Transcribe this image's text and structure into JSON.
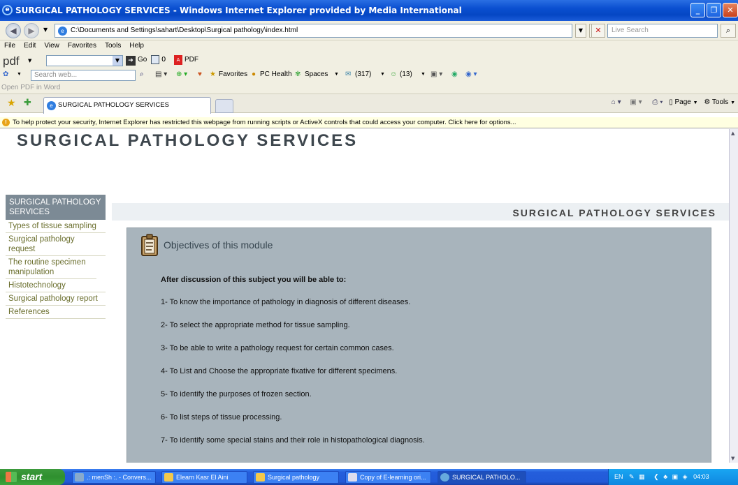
{
  "window": {
    "title": "SURGICAL PATHOLOGY SERVICES - Windows Internet Explorer provided by Media International"
  },
  "address": {
    "url": "C:\\Documents and Settings\\sahart\\Desktop\\Surgical pathology\\index.html",
    "search_placeholder": "Live Search"
  },
  "menu": {
    "items": [
      "File",
      "Edit",
      "View",
      "Favorites",
      "Tools",
      "Help"
    ]
  },
  "pdf_toolbar": {
    "logo": "pdf",
    "go_label": "Go",
    "count": "0",
    "pdf_label": "PDF"
  },
  "toolbar2": {
    "search_placeholder": "Search web...",
    "favorites": "Favorites",
    "pc_health": "PC Health",
    "spaces": "Spaces",
    "mail_count": "(317)",
    "people_count": "(13)",
    "open_pdf": "Open PDF in Word"
  },
  "tabs": {
    "active": "SURGICAL PATHOLOGY SERVICES",
    "page_menu": "Page",
    "tools_menu": "Tools"
  },
  "security_bar": {
    "text": "To help protect your security, Internet Explorer has restricted this webpage from running scripts or ActiveX controls that could access your computer. Click here for options..."
  },
  "site": {
    "title": "SURGICAL PATHOLOGY SERVICES",
    "sidebar_header": "SURGICAL PATHOLOGY SERVICES",
    "nav": [
      "Types of tissue sampling",
      "Surgical pathology request",
      "The routine specimen manipulation",
      "Histotechnology",
      "Surgical pathology report",
      "References"
    ],
    "banner": "SURGICAL PATHOLOGY SERVICES",
    "panel_title": "Objectives of this module",
    "intro": "After discussion of this subject you will be able to:",
    "objectives": [
      "1- To know the importance of pathology in diagnosis of different diseases.",
      "2- To select the appropriate method for tissue sampling.",
      "3- To be able to write a pathology request for certain common cases.",
      "4- To List and Choose the appropriate fixative for different specimens.",
      "5- To identify the purposes of frozen section.",
      "6- To list steps of tissue processing.",
      "7- To identify some special stains and their role in histopathological diagnosis."
    ]
  },
  "taskbar": {
    "start": "start",
    "tasks": [
      ".: menSh :. - Convers...",
      "Elearn Kasr El Aini",
      "Surgical pathology",
      "Copy of E-learning ori...",
      "SURGICAL PATHOLO..."
    ],
    "lang": "EN",
    "clock": "04:03"
  }
}
